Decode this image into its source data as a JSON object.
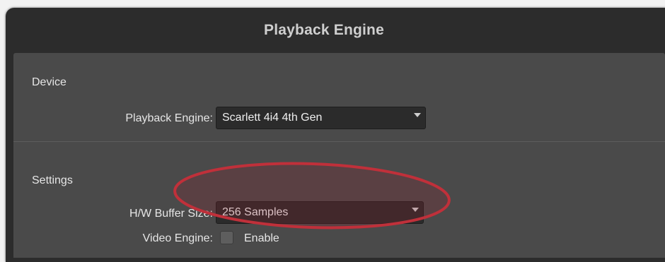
{
  "window": {
    "title": "Playback Engine"
  },
  "device_section": {
    "label": "Device",
    "playback_engine_label": "Playback Engine:",
    "playback_engine_value": "Scarlett 4i4 4th Gen"
  },
  "settings_section": {
    "label": "Settings",
    "buffer_size_label": "H/W Buffer Size:",
    "buffer_size_value": "256 Samples",
    "video_engine_label": "Video Engine:",
    "video_engine_option_label": "Enable",
    "video_engine_enabled": false
  },
  "annotation": {
    "highlight_color": "#c0303a"
  }
}
